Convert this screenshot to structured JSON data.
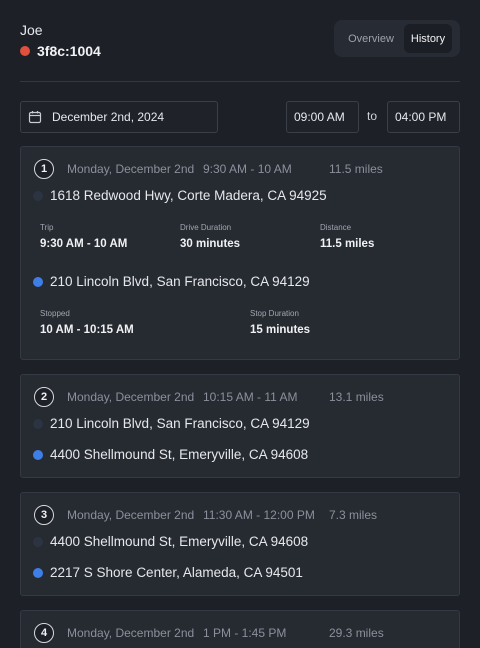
{
  "header": {
    "user_name": "Joe",
    "device_id": "3f8c:1004",
    "status_color": "#e0503c",
    "tabs": [
      {
        "label": "Overview",
        "active": false
      },
      {
        "label": "History",
        "active": true
      }
    ]
  },
  "filters": {
    "date": "December 2nd, 2024",
    "date_icon": "calendar-icon",
    "start_time": "09:00 AM",
    "to_label": "to",
    "end_time": "04:00 PM"
  },
  "trips": [
    {
      "number": "1",
      "date": "Monday, December 2nd",
      "time_range": "9:30 AM - 10 AM",
      "distance": "11.5 miles",
      "from": "1618 Redwood Hwy, Corte Madera, CA 94925",
      "to": "210 Lincoln Blvd, San Francisco, CA 94129",
      "trip_label": "Trip",
      "trip_value": "9:30 AM - 10 AM",
      "drive_label": "Drive Duration",
      "drive_value": "30 minutes",
      "distance_label": "Distance",
      "distance_value": "11.5 miles",
      "stopped_label": "Stopped",
      "stopped_value": "10 AM - 10:15 AM",
      "stop_duration_label": "Stop Duration",
      "stop_duration_value": "15 minutes"
    },
    {
      "number": "2",
      "date": "Monday, December 2nd",
      "time_range": "10:15 AM - 11 AM",
      "distance": "13.1 miles",
      "from": "210 Lincoln Blvd, San Francisco, CA 94129",
      "to": "4400 Shellmound St, Emeryville, CA 94608"
    },
    {
      "number": "3",
      "date": "Monday, December 2nd",
      "time_range": "11:30 AM - 12:00 PM",
      "distance": "7.3 miles",
      "from": "4400 Shellmound St, Emeryville, CA 94608",
      "to": "2217 S Shore Center, Alameda, CA 94501"
    },
    {
      "number": "4",
      "date": "Monday, December 2nd",
      "time_range": "1 PM - 1:45 PM",
      "distance": "29.3 miles"
    }
  ],
  "colors": {
    "background": "#1d2027",
    "card": "#262a31",
    "origin_dot": "#2c3442",
    "destination_dot": "#3e7ee8"
  }
}
